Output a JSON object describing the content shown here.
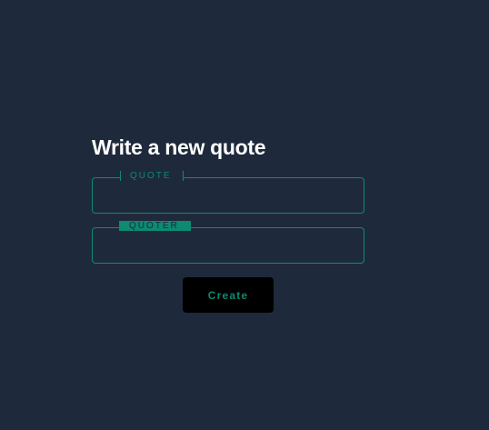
{
  "form": {
    "title": "Write a new quote",
    "quote_field": {
      "label": "QUOTE",
      "value": "",
      "placeholder": ""
    },
    "quoter_field": {
      "label": "QUOTER",
      "value": "",
      "placeholder": ""
    },
    "create_label": "Create"
  },
  "colors": {
    "background": "#1e2a3b",
    "accent": "#0d8a6f",
    "button_background": "#000000",
    "title_text": "#ffffff"
  }
}
